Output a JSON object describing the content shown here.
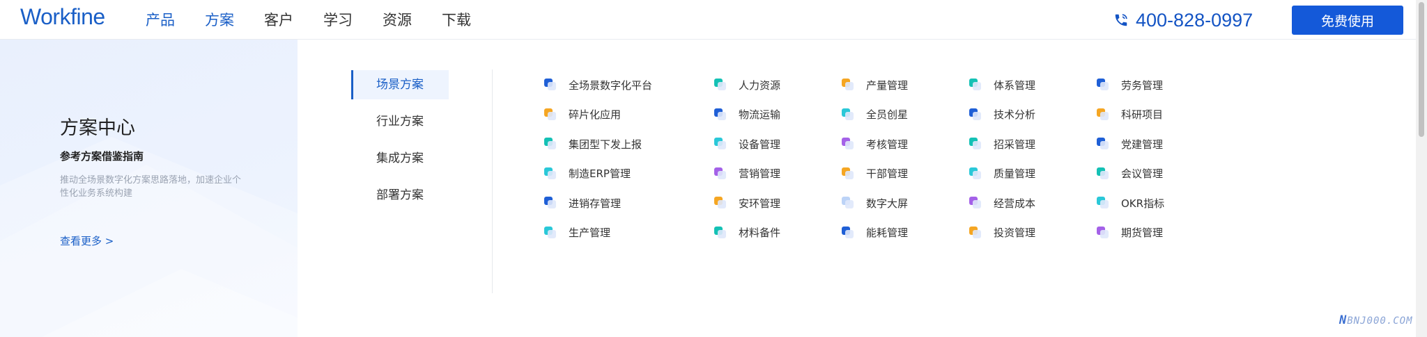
{
  "header": {
    "logo": "Workfine",
    "nav": [
      {
        "label": "产品",
        "highlight": true
      },
      {
        "label": "方案",
        "highlight": true
      },
      {
        "label": "客户",
        "highlight": false
      },
      {
        "label": "学习",
        "highlight": false
      },
      {
        "label": "资源",
        "highlight": false
      },
      {
        "label": "下载",
        "highlight": false
      }
    ],
    "phone": "400-828-0997",
    "cta_label": "免费使用"
  },
  "left_panel": {
    "title": "方案中心",
    "subtitle": "参考方案借鉴指南",
    "description": "推动全场景数字化方案思路落地，加速企业个性化业务系统构建",
    "link": "查看更多 >"
  },
  "tabs": [
    {
      "label": "场景方案",
      "active": true
    },
    {
      "label": "行业方案",
      "active": false
    },
    {
      "label": "集成方案",
      "active": false
    },
    {
      "label": "部署方案",
      "active": false
    }
  ],
  "solutions": [
    [
      "全场景数字化平台",
      "碎片化应用",
      "集团型下发上报",
      "制造ERP管理",
      "进销存管理",
      "生产管理"
    ],
    [
      "人力资源",
      "物流运输",
      "设备管理",
      "营销管理",
      "安环管理",
      "材料备件"
    ],
    [
      "产量管理",
      "全员创星",
      "考核管理",
      "干部管理",
      "数字大屏",
      "能耗管理"
    ],
    [
      "体系管理",
      "技术分析",
      "招采管理",
      "质量管理",
      "经营成本",
      "投资管理"
    ],
    [
      "劳务管理",
      "科研项目",
      "党建管理",
      "会议管理",
      "OKR指标",
      "期货管理"
    ]
  ],
  "solution_icon_colors": [
    [
      "#1f5fd6",
      "#f5a623",
      "#14c1b5",
      "#2ac8d8",
      "#1f5fd6",
      "#2ac8d8"
    ],
    [
      "#14c1b5",
      "#1f5fd6",
      "#2ac8d8",
      "#a461e8",
      "#f5a623",
      "#14c1b5"
    ],
    [
      "#f5a623",
      "#2ac8d8",
      "#a461e8",
      "#f5a623",
      "#bcd3f7",
      "#1f5fd6"
    ],
    [
      "#14c1b5",
      "#1f5fd6",
      "#14c1b5",
      "#2ac8d8",
      "#a461e8",
      "#f5a623"
    ],
    [
      "#1f5fd6",
      "#f5a623",
      "#1f5fd6",
      "#14c1b5",
      "#2ac8d8",
      "#a461e8"
    ]
  ],
  "watermark": {
    "mark": "N",
    "text": "BNJ000.COM"
  },
  "colors": {
    "brand": "#1a5fc7",
    "cta": "#1459d9"
  }
}
